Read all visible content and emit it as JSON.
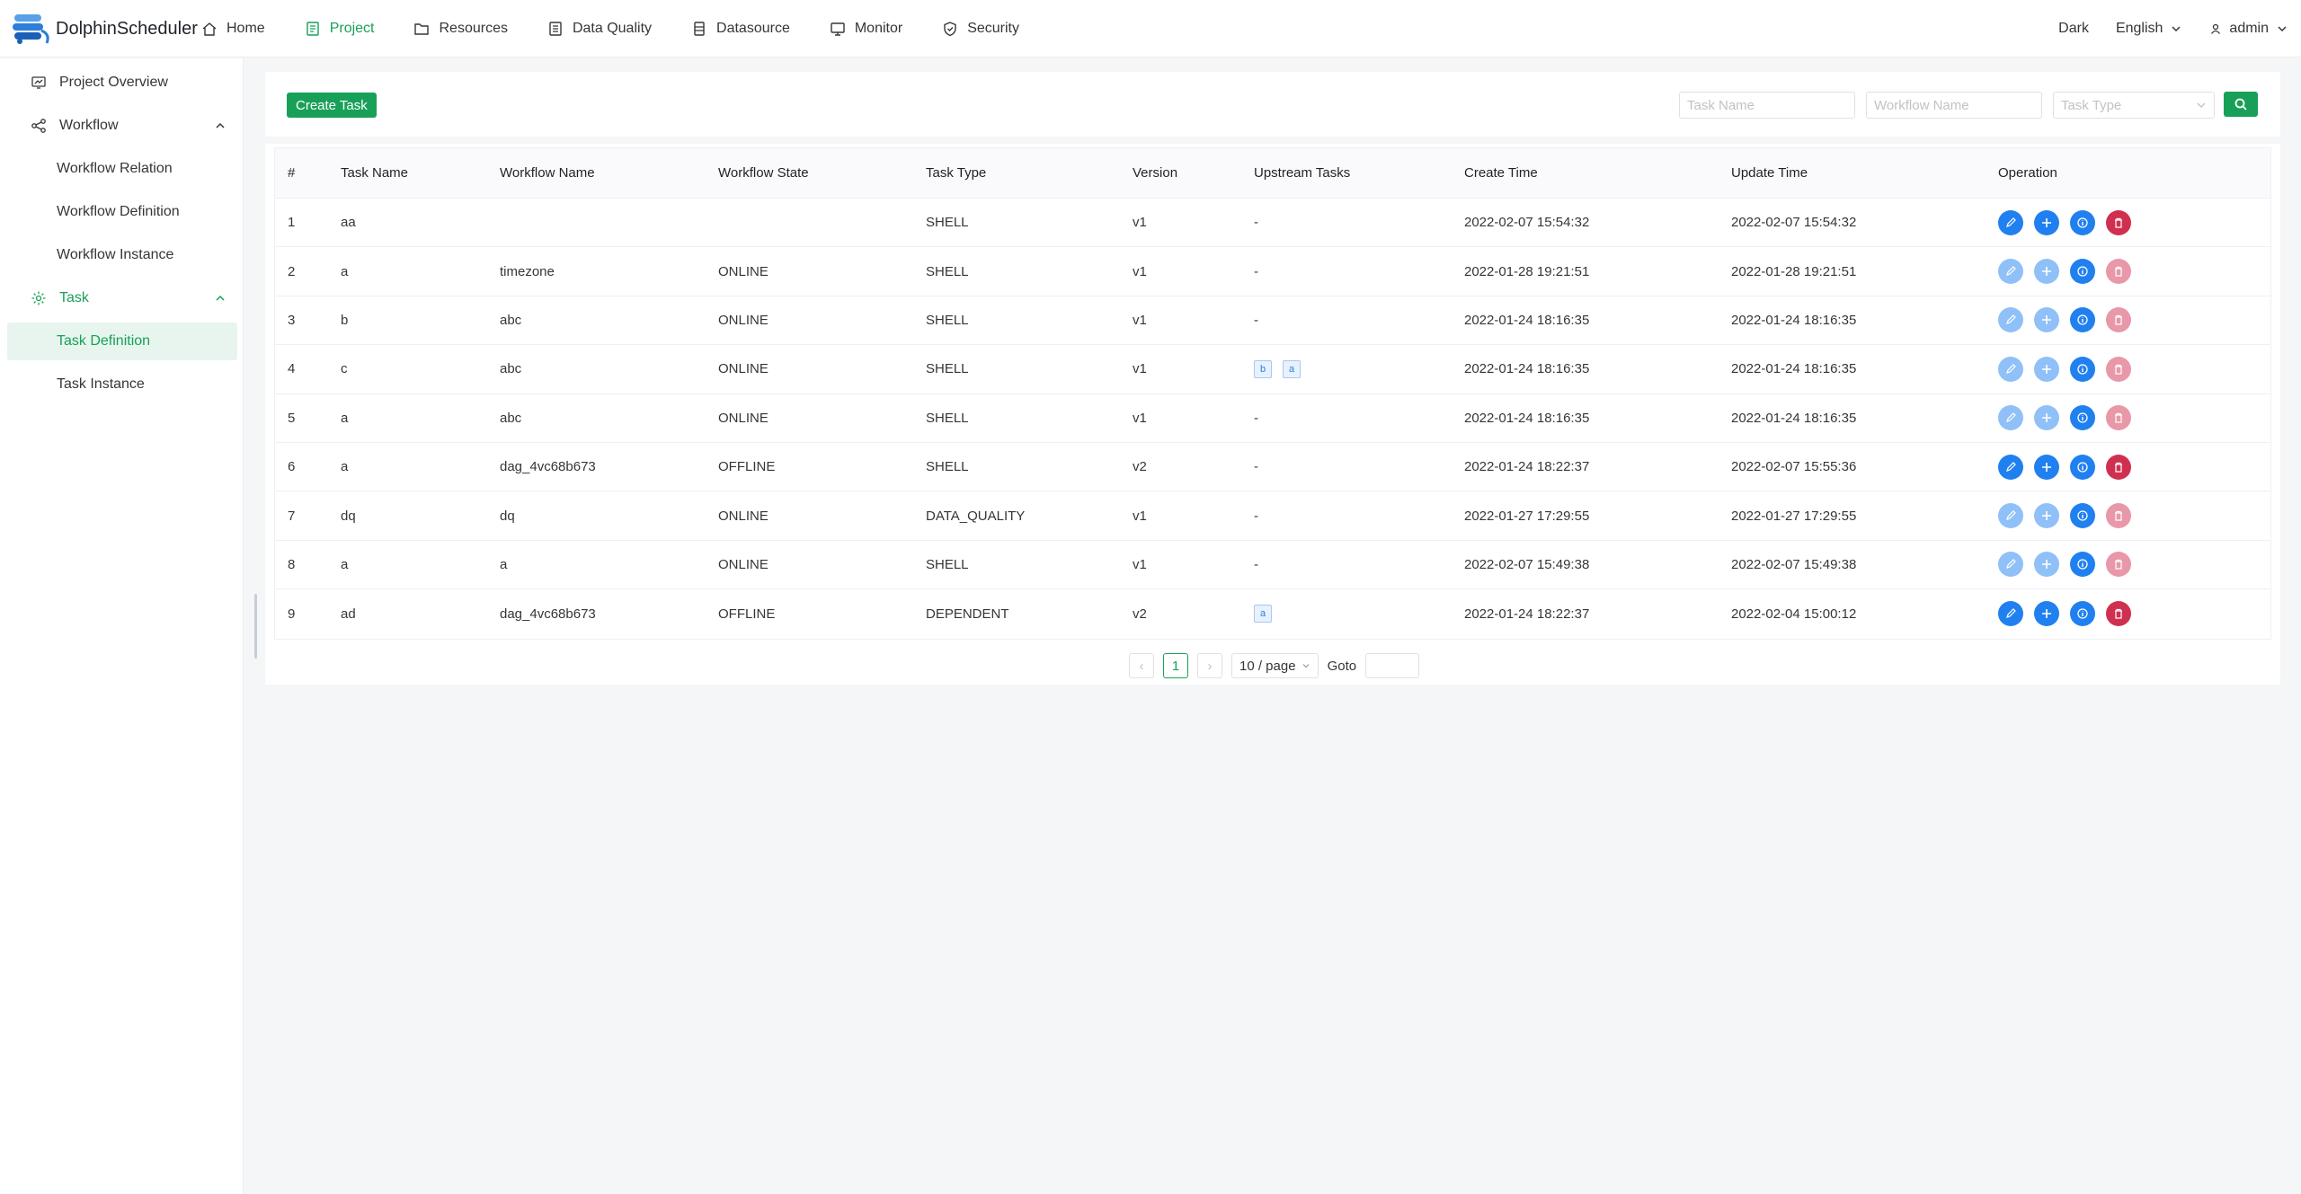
{
  "app": {
    "name": "DolphinScheduler"
  },
  "nav": [
    {
      "label": "Home",
      "icon": "home-icon",
      "active": false
    },
    {
      "label": "Project",
      "icon": "project-icon",
      "active": true
    },
    {
      "label": "Resources",
      "icon": "folder-icon",
      "active": false
    },
    {
      "label": "Data Quality",
      "icon": "data-quality-icon",
      "active": false
    },
    {
      "label": "Datasource",
      "icon": "database-icon",
      "active": false
    },
    {
      "label": "Monitor",
      "icon": "monitor-icon",
      "active": false
    },
    {
      "label": "Security",
      "icon": "shield-icon",
      "active": false
    }
  ],
  "header_right": {
    "theme": "Dark",
    "language": "English",
    "user": "admin"
  },
  "sidebar": {
    "overview": "Project Overview",
    "workflow": {
      "label": "Workflow",
      "children": [
        "Workflow Relation",
        "Workflow Definition",
        "Workflow Instance"
      ]
    },
    "task": {
      "label": "Task",
      "children": [
        "Task Definition",
        "Task Instance"
      ],
      "selected": "Task Definition"
    }
  },
  "toolbar": {
    "create_label": "Create Task",
    "task_name_placeholder": "Task Name",
    "workflow_name_placeholder": "Workflow Name",
    "task_type_placeholder": "Task Type"
  },
  "table": {
    "columns": [
      "#",
      "Task Name",
      "Workflow Name",
      "Workflow State",
      "Task Type",
      "Version",
      "Upstream Tasks",
      "Create Time",
      "Update Time",
      "Operation"
    ],
    "rows": [
      {
        "id": "1",
        "task": "aa",
        "workflow": "",
        "state": "",
        "type": "SHELL",
        "version": "v1",
        "upstream": "-",
        "upstream_tags": [],
        "create": "2022-02-07 15:54:32",
        "update": "2022-02-07 15:54:32",
        "ops_enabled": true
      },
      {
        "id": "2",
        "task": "a",
        "workflow": "timezone",
        "state": "ONLINE",
        "type": "SHELL",
        "version": "v1",
        "upstream": "-",
        "upstream_tags": [],
        "create": "2022-01-28 19:21:51",
        "update": "2022-01-28 19:21:51",
        "ops_enabled": false
      },
      {
        "id": "3",
        "task": "b",
        "workflow": "abc",
        "state": "ONLINE",
        "type": "SHELL",
        "version": "v1",
        "upstream": "-",
        "upstream_tags": [],
        "create": "2022-01-24 18:16:35",
        "update": "2022-01-24 18:16:35",
        "ops_enabled": false
      },
      {
        "id": "4",
        "task": "c",
        "workflow": "abc",
        "state": "ONLINE",
        "type": "SHELL",
        "version": "v1",
        "upstream": "",
        "upstream_tags": [
          "b",
          "a"
        ],
        "create": "2022-01-24 18:16:35",
        "update": "2022-01-24 18:16:35",
        "ops_enabled": false
      },
      {
        "id": "5",
        "task": "a",
        "workflow": "abc",
        "state": "ONLINE",
        "type": "SHELL",
        "version": "v1",
        "upstream": "-",
        "upstream_tags": [],
        "create": "2022-01-24 18:16:35",
        "update": "2022-01-24 18:16:35",
        "ops_enabled": false
      },
      {
        "id": "6",
        "task": "a",
        "workflow": "dag_4vc68b673",
        "state": "OFFLINE",
        "type": "SHELL",
        "version": "v2",
        "upstream": "-",
        "upstream_tags": [],
        "create": "2022-01-24 18:22:37",
        "update": "2022-02-07 15:55:36",
        "ops_enabled": true
      },
      {
        "id": "7",
        "task": "dq",
        "workflow": "dq",
        "state": "ONLINE",
        "type": "DATA_QUALITY",
        "version": "v1",
        "upstream": "-",
        "upstream_tags": [],
        "create": "2022-01-27 17:29:55",
        "update": "2022-01-27 17:29:55",
        "ops_enabled": false
      },
      {
        "id": "8",
        "task": "a",
        "workflow": "a",
        "state": "ONLINE",
        "type": "SHELL",
        "version": "v1",
        "upstream": "-",
        "upstream_tags": [],
        "create": "2022-02-07 15:49:38",
        "update": "2022-02-07 15:49:38",
        "ops_enabled": false
      },
      {
        "id": "9",
        "task": "ad",
        "workflow": "dag_4vc68b673",
        "state": "OFFLINE",
        "type": "DEPENDENT",
        "version": "v2",
        "upstream": "",
        "upstream_tags": [
          "a"
        ],
        "create": "2022-01-24 18:22:37",
        "update": "2022-02-04 15:00:12",
        "ops_enabled": true
      }
    ]
  },
  "pagination": {
    "prev": "‹",
    "page": "1",
    "next": "›",
    "page_size": "10 / page",
    "goto_label": "Goto"
  },
  "colors": {
    "primary": "#18a058",
    "info": "#2080f0",
    "error": "#d03050"
  }
}
